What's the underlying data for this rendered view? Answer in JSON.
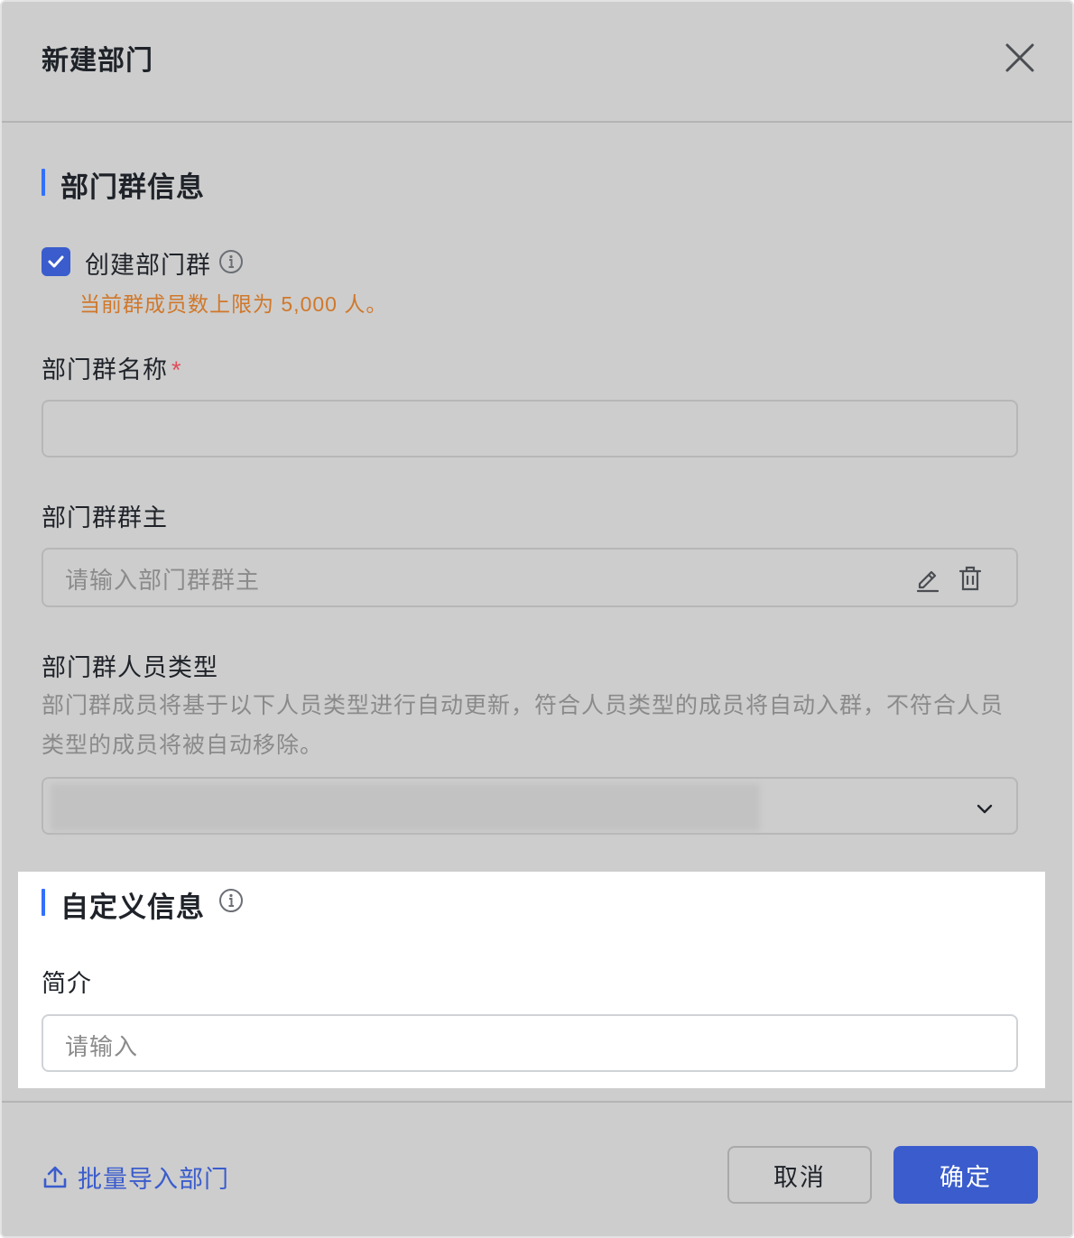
{
  "dialog": {
    "title": "新建部门",
    "close_icon": "close-icon"
  },
  "group_section": {
    "title": "部门群信息",
    "create_group": {
      "label": "创建部门群",
      "checked": true,
      "info_icon": "info-icon",
      "limit_note": "当前群成员数上限为 5,000 人。"
    },
    "group_name": {
      "label": "部门群名称",
      "required_mark": "*",
      "value": ""
    },
    "group_owner": {
      "label": "部门群群主",
      "placeholder": "请输入部门群群主",
      "edit_icon": "edit-icon",
      "delete_icon": "delete-icon"
    },
    "member_type": {
      "label": "部门群人员类型",
      "description": "部门群成员将基于以下人员类型进行自动更新，符合人员类型的成员将自动入群，不符合人员类型的成员将被自动移除。",
      "chevron_icon": "chevron-down-icon"
    }
  },
  "custom_section": {
    "title": "自定义信息",
    "info_icon": "info-icon",
    "intro": {
      "label": "简介",
      "placeholder": "请输入"
    }
  },
  "footer": {
    "import_label": "批量导入部门",
    "import_icon": "upload-icon",
    "cancel_label": "取消",
    "confirm_label": "确定"
  },
  "colors": {
    "accent": "#3a5ccc",
    "section_bar": "#3370ff",
    "warning": "#d0782b",
    "required": "#e34d59"
  }
}
